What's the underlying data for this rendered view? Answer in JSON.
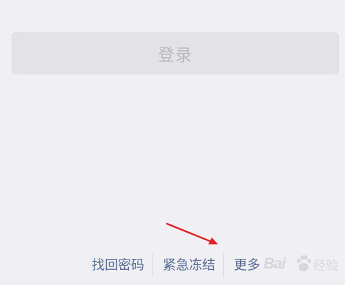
{
  "login_button": {
    "label": "登录"
  },
  "footer_links": {
    "find_password": "找回密码",
    "emergency_freeze": "紧急冻结",
    "more": "更多"
  },
  "watermark": {
    "text": "Bai",
    "text_cn": "经验"
  },
  "colors": {
    "background": "#efeff4",
    "link": "#576b95",
    "button_disabled_bg": "#e3e3e6",
    "button_disabled_text": "#b8b8bc",
    "arrow": "#e02020"
  }
}
